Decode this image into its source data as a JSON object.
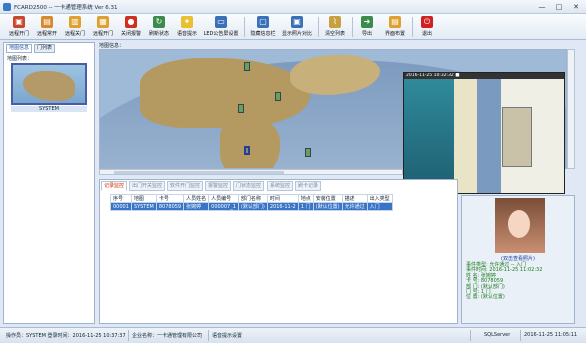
{
  "window": {
    "title": "FCARD2500 -- 一卡通管理系统  Ver 6.31",
    "min": "—",
    "max": "□",
    "close": "✕"
  },
  "toolbar": [
    {
      "label": "远程开门",
      "icon": "open-door-icon",
      "color": "#c9482c"
    },
    {
      "label": "远程常开",
      "icon": "always-open-icon",
      "color": "#d88a2a"
    },
    {
      "label": "远程关门",
      "icon": "close-door-icon",
      "color": "#e0a030"
    },
    {
      "label": "远程开门",
      "icon": "remote-open-icon",
      "color": "#e0a030"
    },
    {
      "label": "关闭报警",
      "icon": "alarm-off-icon",
      "color": "#d03020"
    },
    {
      "label": "刷新状态",
      "icon": "refresh-status-icon",
      "color": "#3b8c4a"
    },
    {
      "label": "语音提示",
      "icon": "bulb-icon",
      "color": "#e8c030"
    },
    {
      "label": "LED公告屏设置",
      "icon": "led-screen-icon",
      "color": "#3a70b8"
    },
    {
      "label": "隐藏信息栏",
      "icon": "hide-panel-icon",
      "color": "#3a70b8"
    },
    {
      "label": "显示照片对比",
      "icon": "photo-compare-icon",
      "color": "#3a70b8"
    },
    {
      "label": "清空列表",
      "icon": "broom-icon",
      "color": "#c8a040"
    },
    {
      "label": "导出",
      "icon": "export-icon",
      "color": "#3b8c4a"
    },
    {
      "label": "界面布置",
      "icon": "layout-icon",
      "color": "#e0a030"
    },
    {
      "label": "退出",
      "icon": "exit-icon",
      "color": "#d02020"
    }
  ],
  "left_panel": {
    "tabs": [
      "地图信息",
      "门列表"
    ],
    "list_label": "地图列表：",
    "thumbnail_caption": "SYSTEM"
  },
  "map": {
    "label": "地图信息：",
    "camera_timestamp": "2016-11-25 10:32:32 ■",
    "camera_tag": "IPC"
  },
  "events": {
    "tabs": [
      "记录监控",
      "出门开关监控",
      "软件开门监控",
      "报警监控",
      "门状态监控",
      "系统监控",
      "刷卡记录"
    ],
    "columns": [
      "序号",
      "地图",
      "卡号",
      "人员姓名",
      "人员编号",
      "部门名称",
      "时间",
      "地点",
      "安装位置",
      "描述",
      "出入类型"
    ],
    "rows": [
      [
        "00001",
        "SYSTEM",
        "8078059",
        "张婉婷",
        "000007_1",
        "(默认部门)",
        "2016-11-2",
        "1 门",
        "(默认位置)",
        "允许通过",
        "入门"
      ]
    ]
  },
  "photo_panel": {
    "link": "(双击查看照片)",
    "info": [
      "事件类型: 允许通过 -- 入门",
      "事件时间: 2016-11-25 11:02:32",
      "姓    名: 张婉婷",
      "卡    号: 8078059",
      "部    门: (默认部门)",
      "门    号: 1 门",
      "位    置: (默认位置)"
    ]
  },
  "status": {
    "operator": "操作员：SYSTEM  登录时间：2016-11-25 10:37:37",
    "company": "企业名称：一卡通管理有限公司",
    "voice": "语音提示设置",
    "server": "SQLServer",
    "clock": "2016-11-25  11:05:11"
  }
}
